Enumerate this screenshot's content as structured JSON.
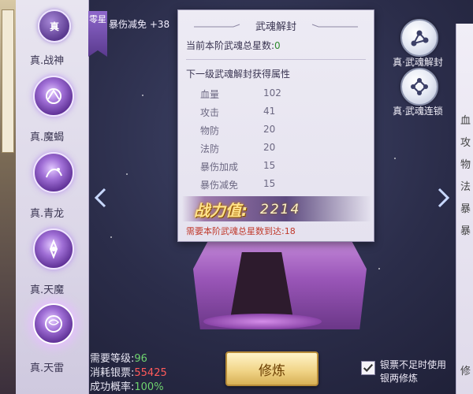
{
  "left_panel": {
    "badge": "真",
    "skills": [
      {
        "label": "真.战神",
        "icon": "wolf-emblem-icon"
      },
      {
        "label": "真.魔蝎",
        "icon": "dragon-emblem-icon"
      },
      {
        "label": "真.青龙",
        "icon": "demon-emblem-icon"
      },
      {
        "label": "真.天魔",
        "icon": "thunder-emblem-icon"
      },
      {
        "label": "真.天雷"
      }
    ]
  },
  "rank_flag": {
    "label": "零星",
    "bonus": "暴伤减免 +38"
  },
  "tooltip": {
    "title": "武魂解封",
    "current_total_label": "当前本阶武魂总星数:",
    "current_total_value": "0",
    "next_header": "下一级武魂解封获得属性",
    "attributes": [
      {
        "name": "血量",
        "value": "102"
      },
      {
        "name": "攻击",
        "value": "41"
      },
      {
        "name": "物防",
        "value": "20"
      },
      {
        "name": "法防",
        "value": "20"
      },
      {
        "name": "暴伤加成",
        "value": "15"
      },
      {
        "name": "暴伤减免",
        "value": "15"
      }
    ],
    "power_label": "战力值:",
    "power_value": "2214",
    "requirement": "需要本阶武魂总星数到达:18"
  },
  "actions": [
    {
      "label": "真·武魂解封",
      "icon": "constellation-icon"
    },
    {
      "label": "真·武魂连锁",
      "icon": "chain-icon"
    }
  ],
  "right_panel_chars": [
    "血",
    "攻",
    "物",
    "法",
    "暴",
    "暴",
    "修"
  ],
  "bottom": {
    "level_label": "需要等级:",
    "level_value": "96",
    "cost_label": "消耗银票:",
    "cost_value": "55425",
    "rate_label": "成功概率:",
    "rate_value": "100%",
    "cultivate_label": "修炼",
    "checkbox_checked": true,
    "checkbox_label": "银票不足时使用银两修炼"
  },
  "colors": {
    "accent_purple": "#8e67cc",
    "green": "#6fd46f",
    "red": "#ff5a5a",
    "gold": "#f1d589"
  }
}
